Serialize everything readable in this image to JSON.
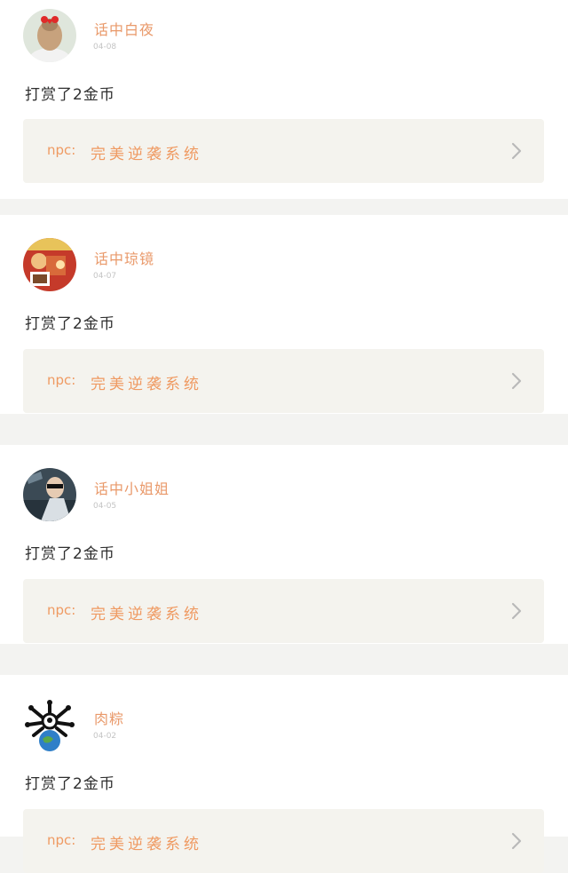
{
  "feed": {
    "items": [
      {
        "username": "话中白夜",
        "date": "04-08",
        "action": "打赏了2金币",
        "book_prefix": "npc:",
        "book_title": "完美逆袭系统",
        "avatar_icon": "girl-red-bow-avatar"
      },
      {
        "username": "话中琼镜",
        "date": "04-07",
        "action": "打赏了2金币",
        "book_prefix": "npc:",
        "book_title": "完美逆袭系统",
        "avatar_icon": "cartoon-avatar"
      },
      {
        "username": "话中小姐姐",
        "date": "04-05",
        "action": "打赏了2金币",
        "book_prefix": "npc:",
        "book_title": "完美逆袭系统",
        "avatar_icon": "photo-avatar"
      },
      {
        "username": "肉粽",
        "date": "04-02",
        "action": "打赏了2金币",
        "book_prefix": "npc:",
        "book_title": "完美逆袭系统",
        "avatar_icon": "globe-avatar"
      }
    ]
  },
  "colors": {
    "accent": "#ef9a62",
    "username": "#e9996a",
    "date": "#c4c4c4",
    "text": "#2f2f2f",
    "card_bg": "#ffffff",
    "page_bg": "#f3f3f1",
    "link_bg": "#f4f3ee"
  }
}
